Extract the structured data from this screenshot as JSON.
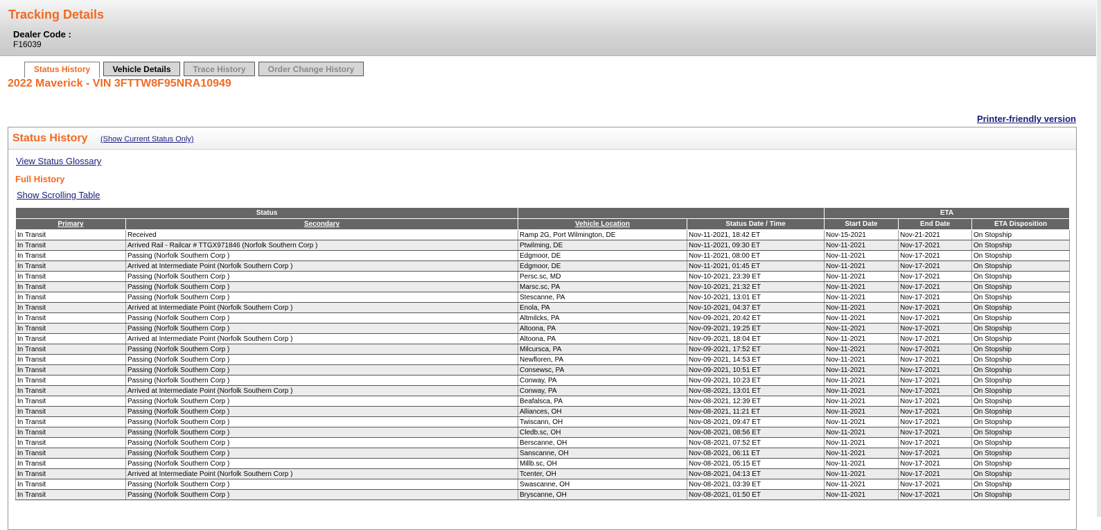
{
  "header": {
    "title": "Tracking Details",
    "dealer_code_label": "Dealer Code :",
    "dealer_code_value": "F16039"
  },
  "tabs": [
    {
      "label": "Status History",
      "state": "active"
    },
    {
      "label": "Vehicle Details",
      "state": "normal"
    },
    {
      "label": "Trace History",
      "state": "disabled"
    },
    {
      "label": "Order Change History",
      "state": "disabled"
    }
  ],
  "vehicle_title": "2022 Maverick - VIN 3FTTW8F95NRA10949",
  "printer_link": "Printer-friendly version",
  "panel": {
    "title": "Status History",
    "show_current": "(Show Current Status Only)",
    "glossary_link": "View Status Glossary",
    "section_title": "Full History",
    "scroll_link": "Show Scrolling Table"
  },
  "table": {
    "group_headers": {
      "status": "Status",
      "location": "",
      "eta": "ETA"
    },
    "columns": [
      "Primary",
      "Secondary",
      "Vehicle Location",
      "Status Date / Time",
      "Start Date",
      "End Date",
      "ETA Disposition"
    ],
    "rows": [
      [
        "In Transit",
        "Received",
        "Ramp 2G, Port Wilmington, DE",
        "Nov-11-2021, 18:42 ET",
        "Nov-15-2021",
        "Nov-21-2021",
        "On Stopship"
      ],
      [
        "In Transit",
        "Arrived Rail - Railcar # TTGX971846 (Norfolk Southern Corp )",
        "Ptwilming, DE",
        "Nov-11-2021, 09:30 ET",
        "Nov-11-2021",
        "Nov-17-2021",
        "On Stopship"
      ],
      [
        "In Transit",
        "Passing (Norfolk Southern Corp )",
        "Edgmoor, DE",
        "Nov-11-2021, 08:00 ET",
        "Nov-11-2021",
        "Nov-17-2021",
        "On Stopship"
      ],
      [
        "In Transit",
        "Arrived at Intermediate Point (Norfolk Southern Corp )",
        "Edgmoor, DE",
        "Nov-11-2021, 01:45 ET",
        "Nov-11-2021",
        "Nov-17-2021",
        "On Stopship"
      ],
      [
        "In Transit",
        "Passing (Norfolk Southern Corp )",
        "Persc.sc, MD",
        "Nov-10-2021, 23:39 ET",
        "Nov-11-2021",
        "Nov-17-2021",
        "On Stopship"
      ],
      [
        "In Transit",
        "Passing (Norfolk Southern Corp )",
        "Marsc.sc, PA",
        "Nov-10-2021, 21:32 ET",
        "Nov-11-2021",
        "Nov-17-2021",
        "On Stopship"
      ],
      [
        "In Transit",
        "Passing (Norfolk Southern Corp )",
        "Stescanne, PA",
        "Nov-10-2021, 13:01 ET",
        "Nov-11-2021",
        "Nov-17-2021",
        "On Stopship"
      ],
      [
        "In Transit",
        "Arrived at Intermediate Point (Norfolk Southern Corp )",
        "Enola, PA",
        "Nov-10-2021, 04:37 ET",
        "Nov-11-2021",
        "Nov-17-2021",
        "On Stopship"
      ],
      [
        "In Transit",
        "Passing (Norfolk Southern Corp )",
        "Altmilcks, PA",
        "Nov-09-2021, 20:42 ET",
        "Nov-11-2021",
        "Nov-17-2021",
        "On Stopship"
      ],
      [
        "In Transit",
        "Passing (Norfolk Southern Corp )",
        "Altoona, PA",
        "Nov-09-2021, 19:25 ET",
        "Nov-11-2021",
        "Nov-17-2021",
        "On Stopship"
      ],
      [
        "In Transit",
        "Arrived at Intermediate Point (Norfolk Southern Corp )",
        "Altoona, PA",
        "Nov-09-2021, 18:04 ET",
        "Nov-11-2021",
        "Nov-17-2021",
        "On Stopship"
      ],
      [
        "In Transit",
        "Passing (Norfolk Southern Corp )",
        "Milcursca, PA",
        "Nov-09-2021, 17:52 ET",
        "Nov-11-2021",
        "Nov-17-2021",
        "On Stopship"
      ],
      [
        "In Transit",
        "Passing (Norfolk Southern Corp )",
        "Newfloren, PA",
        "Nov-09-2021, 14:53 ET",
        "Nov-11-2021",
        "Nov-17-2021",
        "On Stopship"
      ],
      [
        "In Transit",
        "Passing (Norfolk Southern Corp )",
        "Consewsc, PA",
        "Nov-09-2021, 10:51 ET",
        "Nov-11-2021",
        "Nov-17-2021",
        "On Stopship"
      ],
      [
        "In Transit",
        "Passing (Norfolk Southern Corp )",
        "Conway, PA",
        "Nov-09-2021, 10:23 ET",
        "Nov-11-2021",
        "Nov-17-2021",
        "On Stopship"
      ],
      [
        "In Transit",
        "Arrived at Intermediate Point (Norfolk Southern Corp )",
        "Conway, PA",
        "Nov-08-2021, 13:01 ET",
        "Nov-11-2021",
        "Nov-17-2021",
        "On Stopship"
      ],
      [
        "In Transit",
        "Passing (Norfolk Southern Corp )",
        "Beafalsca, PA",
        "Nov-08-2021, 12:39 ET",
        "Nov-11-2021",
        "Nov-17-2021",
        "On Stopship"
      ],
      [
        "In Transit",
        "Passing (Norfolk Southern Corp )",
        "Alliances, OH",
        "Nov-08-2021, 11:21 ET",
        "Nov-11-2021",
        "Nov-17-2021",
        "On Stopship"
      ],
      [
        "In Transit",
        "Passing (Norfolk Southern Corp )",
        "Twiscann, OH",
        "Nov-08-2021, 09:47 ET",
        "Nov-11-2021",
        "Nov-17-2021",
        "On Stopship"
      ],
      [
        "In Transit",
        "Passing (Norfolk Southern Corp )",
        "Cledb.sc, OH",
        "Nov-08-2021, 08:56 ET",
        "Nov-11-2021",
        "Nov-17-2021",
        "On Stopship"
      ],
      [
        "In Transit",
        "Passing (Norfolk Southern Corp )",
        "Berscanne, OH",
        "Nov-08-2021, 07:52 ET",
        "Nov-11-2021",
        "Nov-17-2021",
        "On Stopship"
      ],
      [
        "In Transit",
        "Passing (Norfolk Southern Corp )",
        "Sanscanne, OH",
        "Nov-08-2021, 06:11 ET",
        "Nov-11-2021",
        "Nov-17-2021",
        "On Stopship"
      ],
      [
        "In Transit",
        "Passing (Norfolk Southern Corp )",
        "Millb.sc, OH",
        "Nov-08-2021, 05:15 ET",
        "Nov-11-2021",
        "Nov-17-2021",
        "On Stopship"
      ],
      [
        "In Transit",
        "Arrived at Intermediate Point (Norfolk Southern Corp )",
        "Tcenter, OH",
        "Nov-08-2021, 04:13 ET",
        "Nov-11-2021",
        "Nov-17-2021",
        "On Stopship"
      ],
      [
        "In Transit",
        "Passing (Norfolk Southern Corp )",
        "Swascanne, OH",
        "Nov-08-2021, 03:39 ET",
        "Nov-11-2021",
        "Nov-17-2021",
        "On Stopship"
      ],
      [
        "In Transit",
        "Passing (Norfolk Southern Corp )",
        "Bryscanne, OH",
        "Nov-08-2021, 01:50 ET",
        "Nov-11-2021",
        "Nov-17-2021",
        "On Stopship"
      ]
    ]
  }
}
